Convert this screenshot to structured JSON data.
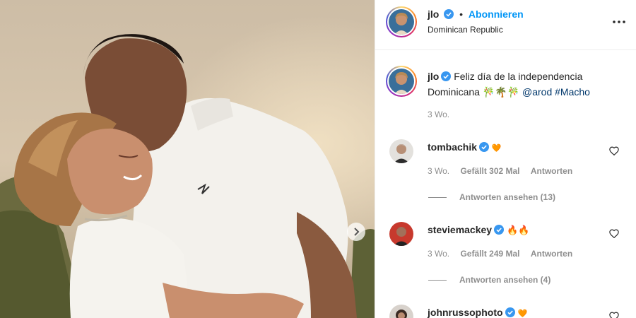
{
  "post": {
    "author": "jlo",
    "follow_label": "Abonnieren",
    "separator": "•",
    "location": "Dominican Republic",
    "caption_text": "Feliz día de la independencia Dominicana",
    "caption_emoji": "🎋🌴🎋",
    "caption_mention": "@arod",
    "caption_hashtag": "#Macho",
    "caption_age": "3 Wo."
  },
  "comments": [
    {
      "user": "tombachik",
      "emoji": "🧡",
      "age": "3 Wo.",
      "likes": "Gefällt 302 Mal",
      "reply_label": "Antworten",
      "view_replies": "Antworten ansehen (13)"
    },
    {
      "user": "steviemackey",
      "emoji": "🔥🔥",
      "age": "3 Wo.",
      "likes": "Gefällt 249 Mal",
      "reply_label": "Antworten",
      "view_replies": "Antworten ansehen (4)"
    },
    {
      "user": "johnrussophoto",
      "emoji": "🧡"
    }
  ],
  "icons": {
    "verified": "verified-badge-icon",
    "more": "more-options-icon",
    "heart": "heart-icon",
    "next": "chevron-right-icon"
  },
  "colors": {
    "link_blue": "#0095f6",
    "verified_blue": "#3897f0",
    "text": "#262626",
    "muted": "#8e8e8e"
  }
}
